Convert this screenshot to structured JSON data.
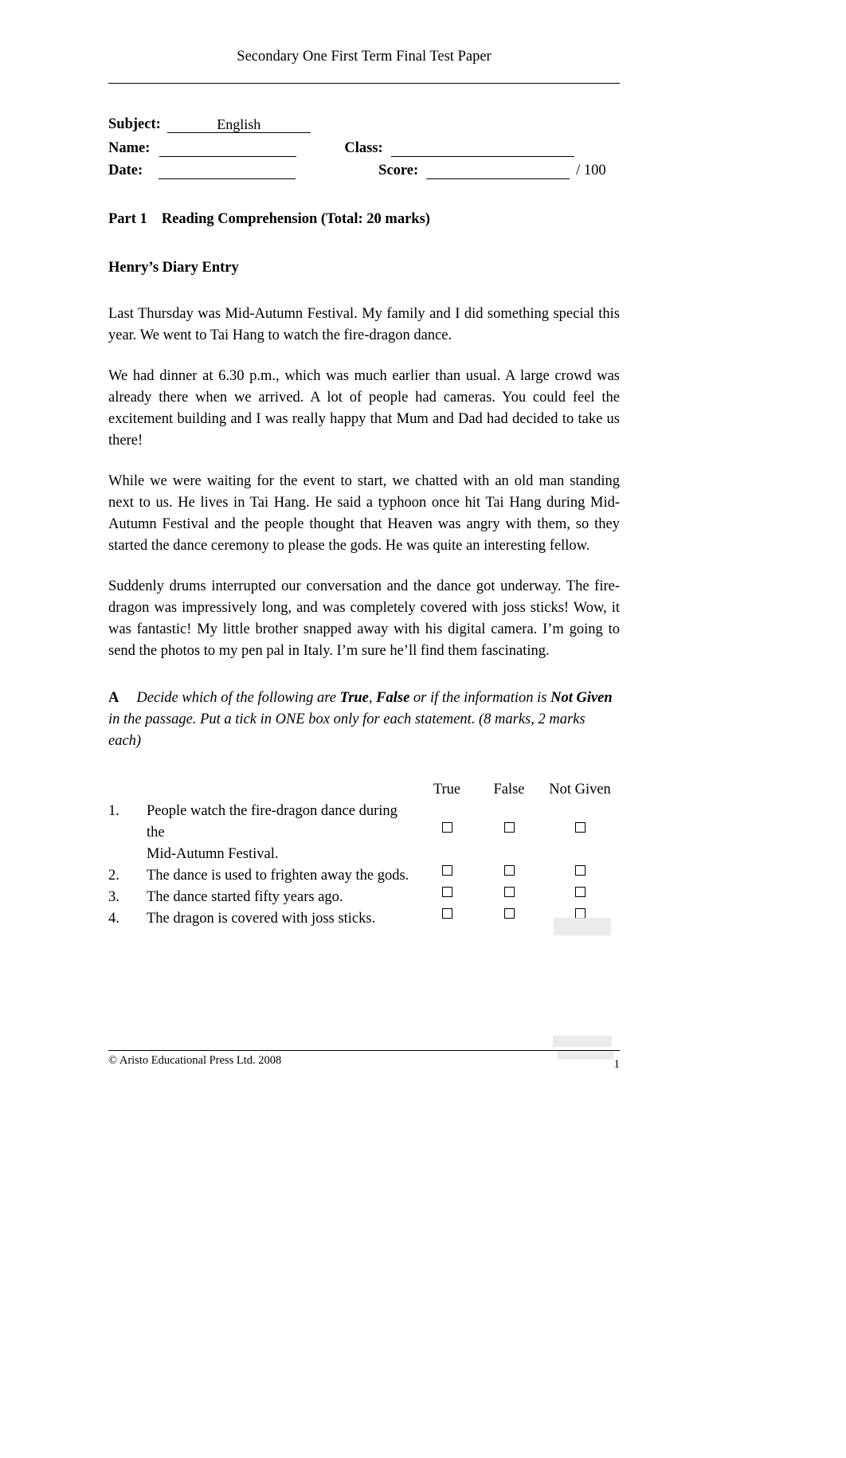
{
  "document": {
    "header_title": "Secondary One First Term Final Test Paper",
    "page_number": "1",
    "footer_copyright": "© Aristo Educational Press Ltd. 2008"
  },
  "form": {
    "subject_label": "Subject:",
    "subject_value": "English",
    "name_label": "Name:",
    "name_value": "",
    "class_label": "Class:",
    "class_value": "",
    "date_label": "Date:",
    "date_value": "",
    "score_label": "Score:",
    "score_value": "",
    "score_total": "/ 100"
  },
  "part": {
    "number": "Part 1",
    "title": "Reading Comprehension (Total: 20 marks)"
  },
  "passage": {
    "title": "Henry’s Diary Entry",
    "paragraphs": [
      "Last Thursday was Mid-Autumn Festival. My family and I did something special this year. We went to Tai Hang to watch the fire-dragon dance.",
      "We had dinner at 6.30 p.m., which was much earlier than usual. A large crowd was already there when we arrived. A lot of people had cameras. You could feel the excitement building and I was really happy that Mum and Dad had decided to take us there!",
      "While we were waiting for the event to start, we chatted with an old man standing next to us. He lives in Tai Hang. He said a typhoon once hit Tai Hang during Mid-Autumn Festival and the people thought that Heaven was angry with them, so they started the dance ceremony to please the gods. He was quite an interesting fellow.",
      "Suddenly drums interrupted our conversation and the dance got underway. The fire-dragon was impressively long, and was completely covered with joss sticks! Wow, it was fantastic! My little brother snapped away with his digital camera. I’m going to send the photos to my pen pal in Italy. I’m sure he’ll find them fascinating."
    ]
  },
  "section_a": {
    "letter": "A",
    "text_1": "Decide which of the following are ",
    "bold_true": "True",
    "text_2": ", ",
    "bold_false": "False",
    "text_3": " or if the information is ",
    "bold_notgiven": "Not Given",
    "text_4": " in the passage. Put a tick in ONE box only for each statement. (8 marks, 2 marks each)"
  },
  "tf_table": {
    "columns": [
      "True",
      "False",
      "Not Given"
    ],
    "rows": [
      {
        "number": "1.",
        "statement_line1": "People watch the fire-dragon dance during the",
        "statement_line2": "Mid-Autumn Festival."
      },
      {
        "number": "2.",
        "statement_line1": "The dance is used to frighten away the gods.",
        "statement_line2": ""
      },
      {
        "number": "3.",
        "statement_line1": "The dance started fifty years ago.",
        "statement_line2": ""
      },
      {
        "number": "4.",
        "statement_line1": "The dragon is covered with joss sticks.",
        "statement_line2": ""
      }
    ]
  }
}
